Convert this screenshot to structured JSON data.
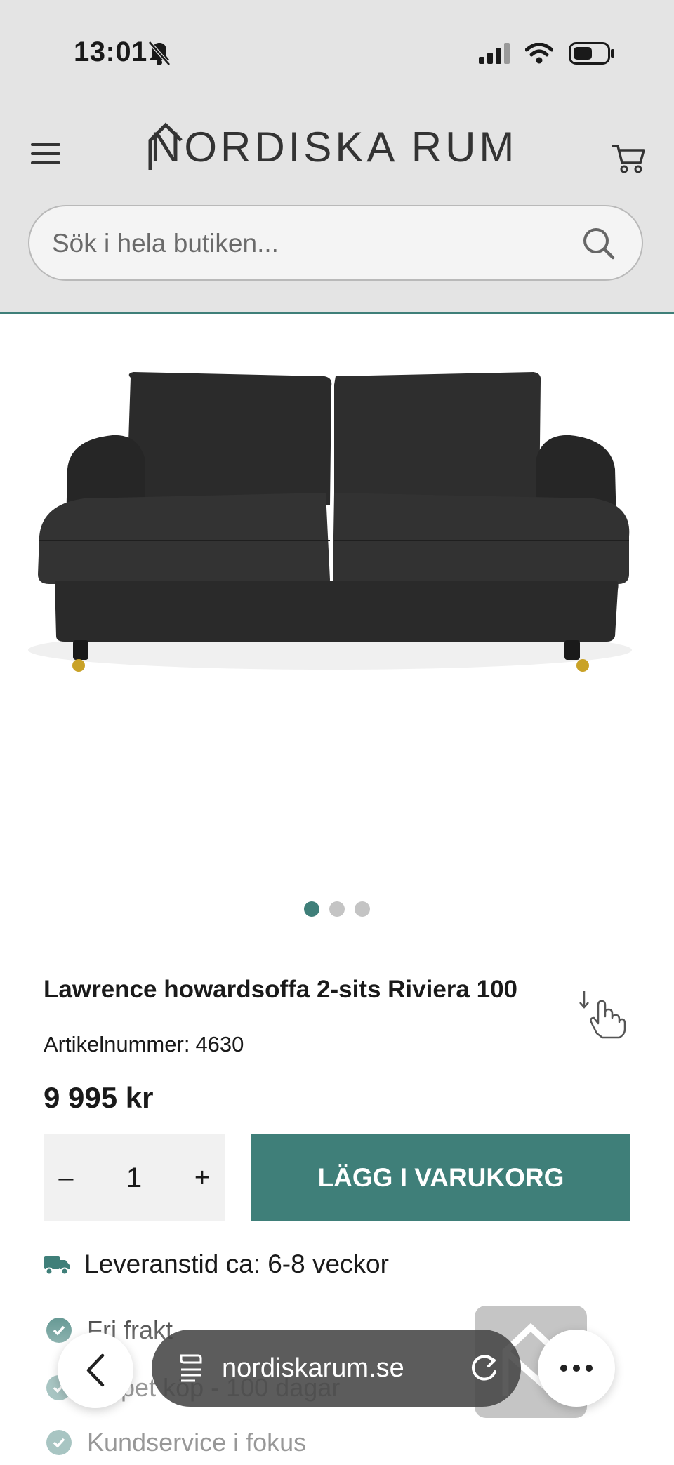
{
  "status": {
    "time": "13:01"
  },
  "header": {
    "brand": "NORDISKA RUM",
    "search_placeholder": "Sök i hela butiken..."
  },
  "gallery": {
    "image_count": 3,
    "active_index": 0
  },
  "product": {
    "title": "Lawrence howardsoffa 2-sits Riviera 100",
    "sku_label": "Artikelnummer:",
    "sku": "4630",
    "price": "9 995 kr",
    "quantity": "1",
    "qty_minus": "–",
    "qty_plus": "+",
    "add_to_cart": "LÄGG I VARUKORG",
    "delivery": "Leveranstid ca: 6-8 veckor",
    "usps": [
      "Fri frakt",
      "Öppet köp - 100 dagar",
      "Kundservice i fokus"
    ]
  },
  "browser": {
    "url": "nordiskarum.se"
  },
  "colors": {
    "accent": "#3f7f79",
    "header_bg": "#e4e4e4"
  }
}
